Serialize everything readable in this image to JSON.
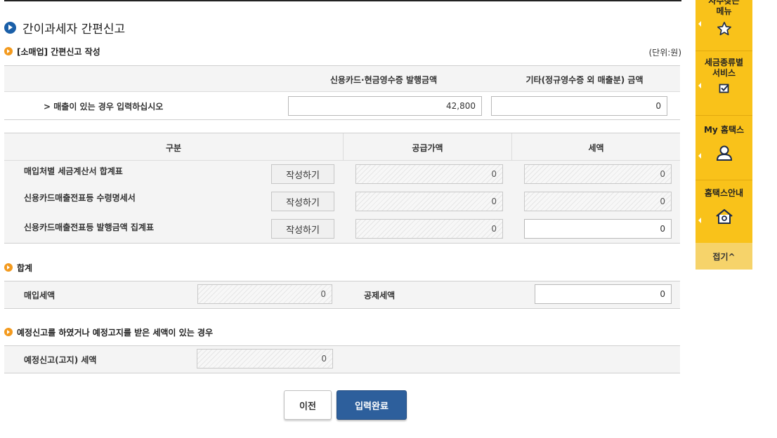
{
  "page": {
    "title": "간이과세자 간편신고",
    "unit": "(단위:원)"
  },
  "sales_section": {
    "title": "[소매업] 간편신고 작성",
    "col_card": "신용카드·현금영수증 발행금액",
    "col_other": "기타(정규영수증 외 매출분) 금액",
    "row_label": "> 매출이 있는 경우 입력하십시오",
    "card_value": "42,800",
    "other_value": "0"
  },
  "detail_table": {
    "col_category": "구분",
    "col_supply": "공급가액",
    "col_tax": "세액",
    "rows": [
      {
        "label": "매입처별 세금계산서 합계표",
        "button": "작성하기",
        "supply": "0",
        "tax": "0"
      },
      {
        "label": "신용카드매출전표등 수령명세서",
        "button": "작성하기",
        "supply": "0",
        "tax": "0"
      },
      {
        "label": "신용카드매출전표등 발행금액 집계표",
        "button": "작성하기",
        "supply": "0",
        "tax": "0"
      }
    ]
  },
  "total_section": {
    "title": "합계",
    "purchase_tax_label": "매입세액",
    "purchase_tax_value": "0",
    "deduction_tax_label": "공제세액",
    "deduction_tax_value": "0"
  },
  "prelim_section": {
    "title": "예정신고를 하였거나 예정고지를 받은 세액이 있는 경우",
    "label": "예정신고(고지) 세액",
    "value": "0"
  },
  "buttons": {
    "prev": "이전",
    "done": "입력완료"
  },
  "quick_menu": {
    "item1": "자주찾는 메뉴",
    "item1_line1": "자주찾는",
    "item1_line2": "메뉴",
    "item2_line1": "세금종류별",
    "item2_line2": "서비스",
    "item3": "My 홈택스",
    "item4": "홈택스안내",
    "fold": "접기^"
  },
  "colors": {
    "accent_blue": "#2d5f9c",
    "quick_menu_yellow": "#f9c21a",
    "bullet_orange": "#f39a1e"
  }
}
